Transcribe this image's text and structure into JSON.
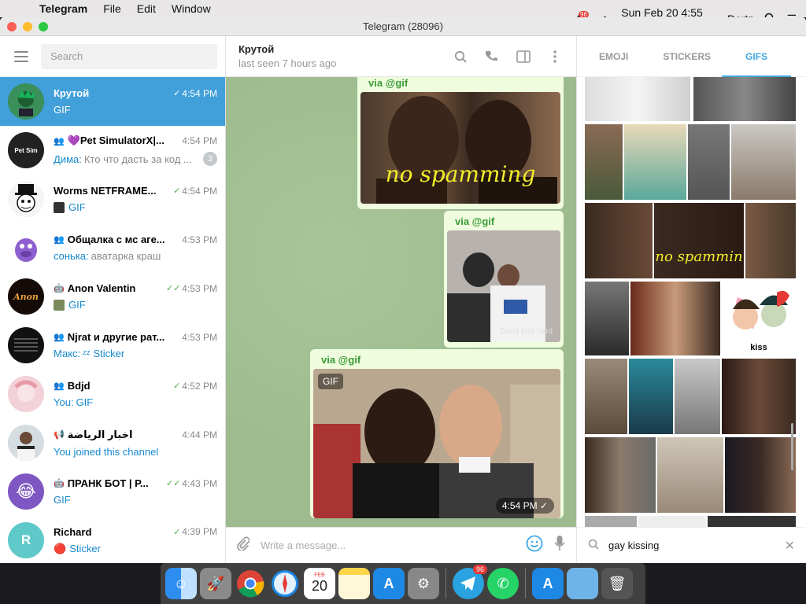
{
  "menubar": {
    "app": "Telegram",
    "items": [
      "File",
      "Edit",
      "Window"
    ],
    "tray_badge": "96",
    "datetime": "Sun Feb 20  4:55 PM",
    "user": "Dartz"
  },
  "window": {
    "title": "Telegram (28096)"
  },
  "sidebar": {
    "search_placeholder": "Search",
    "chats": [
      {
        "name": "Крутой",
        "time": "4:54 PM",
        "sender": "",
        "preview": "GIF",
        "checks": "✓",
        "unread": "",
        "color": "#2e8b57",
        "active": true
      },
      {
        "name": "💜Pet SimulatorX|...",
        "time": "4:54 PM",
        "sender": "Дима:",
        "preview": "Кто что дасть за код ...",
        "checks": "",
        "unread": "3",
        "color": "#222222"
      },
      {
        "name": "Worms NETFRAME...",
        "time": "4:54 PM",
        "sender": "",
        "preview": "GIF",
        "checks": "✓",
        "unread": "",
        "color": "#f5f5f5"
      },
      {
        "name": "Общалка с мс аге...",
        "time": "4:53 PM",
        "sender": "сонька:",
        "preview": "аватарка краш",
        "checks": "",
        "unread": "",
        "color": "#8e5fd0"
      },
      {
        "name": "Anon Valentin",
        "time": "4:53 PM",
        "sender": "",
        "preview": "GIF",
        "checks": "✓✓",
        "unread": "",
        "color": "#140b08"
      },
      {
        "name": "Njrat и другие рат...",
        "time": "4:53 PM",
        "sender": "Макс:",
        "preview": "Sticker",
        "checks": "",
        "unread": "",
        "color": "#111111"
      },
      {
        "name": "Bdjd",
        "time": "4:52 PM",
        "sender": "You:",
        "preview": "GIF",
        "checks": "✓",
        "unread": "",
        "color": "#f0c8d0"
      },
      {
        "name": "اخبار الرياضة",
        "time": "4:44 PM",
        "sender": "",
        "preview": "You joined this channel",
        "checks": "",
        "unread": "",
        "color": "#cfd8dc"
      },
      {
        "name": "ПРАНК БОТ | Р...",
        "time": "4:43 PM",
        "sender": "",
        "preview": "GIF",
        "checks": "✓✓",
        "unread": "",
        "color": "#7e57c2"
      },
      {
        "name": "Richard",
        "time": "4:39 PM",
        "sender": "",
        "preview": "Sticker",
        "checks": "✓",
        "unread": "",
        "initial": "R",
        "color": "#5fc8c9"
      }
    ]
  },
  "conversation": {
    "title": "Крутой",
    "status": "last seen 7 hours ago",
    "messages": [
      {
        "via": "via @gif",
        "overlay": "no spamming"
      },
      {
        "via": "via @gif",
        "caption": "Don't kiss hard"
      },
      {
        "via": "via @gif",
        "gif_label": "GIF",
        "time": "4:54 PM"
      }
    ],
    "composer_placeholder": "Write a message..."
  },
  "panel": {
    "tabs": [
      "EMOJI",
      "STICKERS",
      "GIFS"
    ],
    "active_tab": "GIFS",
    "search_value": "gay kissing",
    "cell_texts": [
      "no spammin",
      "kiss"
    ]
  },
  "dock": {
    "telegram_badge": "96",
    "calendar_month": "FEB",
    "calendar_day": "20"
  }
}
